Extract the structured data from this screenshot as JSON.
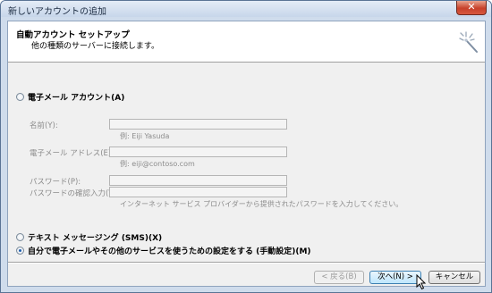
{
  "window": {
    "title": "新しいアカウントの追加",
    "close_label": "✕"
  },
  "header": {
    "title": "自動アカウント セットアップ",
    "subtitle": "他の種類のサーバーに接続します。"
  },
  "options": {
    "email_account": {
      "label": "電子メール アカウント(A)",
      "selected": false
    },
    "sms": {
      "label": "テキスト メッセージング (SMS)(X)",
      "selected": false
    },
    "manual": {
      "label": "自分で電子メールやその他のサービスを使うための設定をする (手動設定)(M)",
      "selected": true
    }
  },
  "fields": {
    "name": {
      "label": "名前(Y):",
      "value": "",
      "hint": "例: Eiji Yasuda"
    },
    "email": {
      "label": "電子メール アドレス(E):",
      "value": "",
      "hint": "例: eiji@contoso.com"
    },
    "password": {
      "label": "パスワード(P):",
      "value": ""
    },
    "password_confirm": {
      "label": "パスワードの確認入力(T):",
      "value": ""
    },
    "password_hint": "インターネット サービス プロバイダーから提供されたパスワードを入力してください。"
  },
  "buttons": {
    "back": "< 戻る(B)",
    "next": "次へ(N) >",
    "cancel": "キャンセル"
  },
  "icons": {
    "wizard": "wizard-sparkle-icon",
    "cursor": "mouse-cursor-icon"
  }
}
